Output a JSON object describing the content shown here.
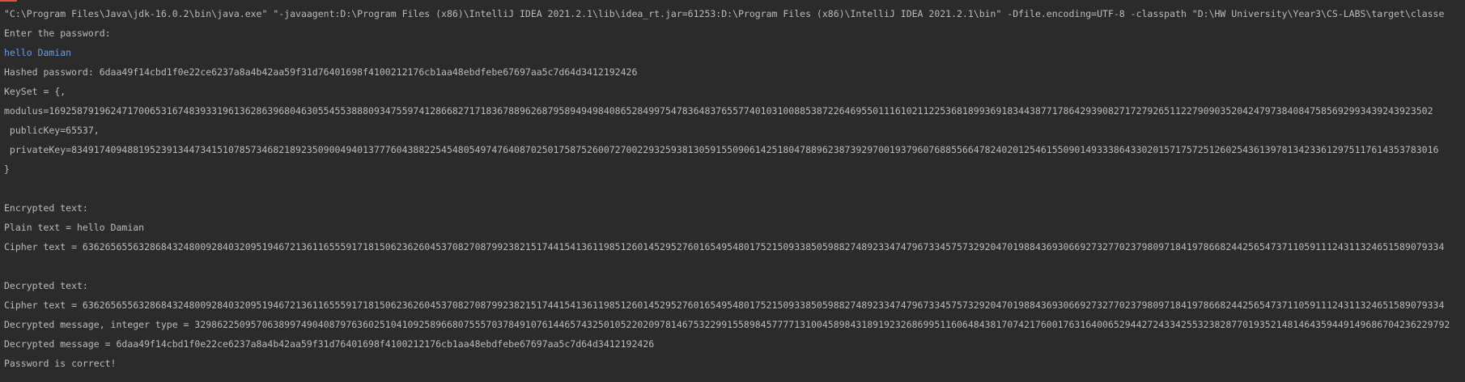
{
  "console": {
    "lines": [
      {
        "kind": "cmd",
        "text": "\"C:\\Program Files\\Java\\jdk-16.0.2\\bin\\java.exe\" \"-javaagent:D:\\Program Files (x86)\\IntelliJ IDEA 2021.2.1\\lib\\idea_rt.jar=61253:D:\\Program Files (x86)\\IntelliJ IDEA 2021.2.1\\bin\" -Dfile.encoding=UTF-8 -classpath \"D:\\HW University\\Year3\\CS-LABS\\target\\classe"
      },
      {
        "kind": "out",
        "text": "Enter the password:"
      },
      {
        "kind": "input",
        "text": "hello Damian"
      },
      {
        "kind": "out",
        "text": "Hashed password: 6daa49f14cbd1f0e22ce6237a8a4b42aa59f31d76401698f4100212176cb1aa48ebdfebe67697aa5c7d64d3412192426"
      },
      {
        "kind": "out",
        "text": "KeySet = {,"
      },
      {
        "kind": "out",
        "text": "modulus=1692587919624717006531674839331961362863968046305545538880934755974128668271718367889626879589494984086528499754783648376557740103100885387226469550111610211225368189936918344387717864293908271727926511227909035204247973840847585692993439243923502"
      },
      {
        "kind": "out",
        "text": " publicKey=65537,"
      },
      {
        "kind": "out",
        "text": " privateKey=8349174094881952391344734151078573468218923509004940137776043882254548054974764087025017587526007270022932593813059155090614251804788962387392970019379607688556647824020125461550901493338643302015717572512602543613978134233612975117614353783016"
      },
      {
        "kind": "out",
        "text": "}"
      },
      {
        "kind": "gap",
        "text": ""
      },
      {
        "kind": "out",
        "text": "Encrypted text:"
      },
      {
        "kind": "out",
        "text": "Plain text = hello Damian"
      },
      {
        "kind": "out",
        "text": "Cipher text = 636265655632868432480092840320951946721361165559171815062362604537082708799238215174415413611985126014529527601654954801752150933850598827489233474796733457573292047019884369306692732770237980971841978668244256547371105911124311324651589079334"
      },
      {
        "kind": "gap",
        "text": ""
      },
      {
        "kind": "out",
        "text": "Decrypted text:"
      },
      {
        "kind": "out",
        "text": "Cipher text = 636265655632868432480092840320951946721361165559171815062362604537082708799238215174415413611985126014529527601654954801752150933850598827489233474796733457573292047019884369306692732770237980971841978668244256547371105911124311324651589079334"
      },
      {
        "kind": "out",
        "text": "Decrypted message, integer type = 32986225095706389974904087976360251041092589668075557037849107614465743250105220209781467532299155898457777131004589843189192326869951160648438170742176001763164006529442724334255323828770193521481464359449149686704236229792"
      },
      {
        "kind": "out",
        "text": "Decrypted message = 6daa49f14cbd1f0e22ce6237a8a4b42aa59f31d76401698f4100212176cb1aa48ebdfebe67697aa5c7d64d3412192426"
      },
      {
        "kind": "out",
        "text": "Password is correct!"
      }
    ]
  },
  "colors": {
    "background": "#2b2b2b",
    "text": "#bbbbbb",
    "input": "#6a9ee0",
    "accent": "#e0503a"
  }
}
